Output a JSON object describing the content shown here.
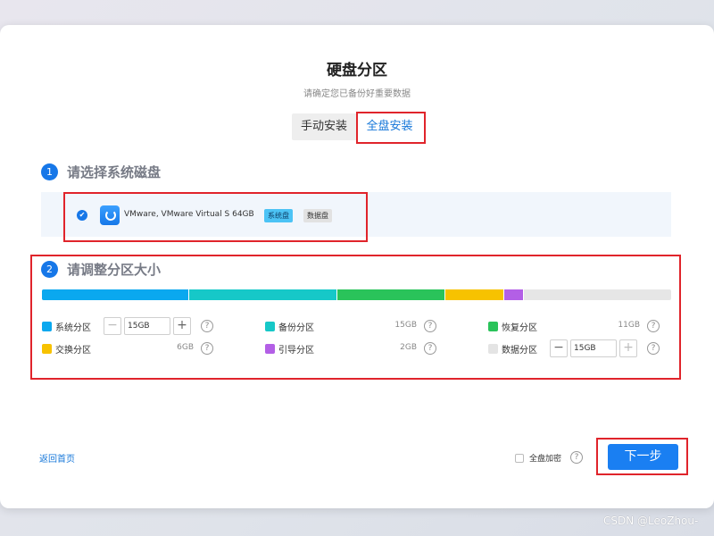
{
  "dialog": {
    "title": "硬盘分区",
    "subtitle": "请确定您已备份好重要数据"
  },
  "tabs": [
    {
      "label": "手动安装",
      "active": false
    },
    {
      "label": "全盘安装",
      "active": true
    }
  ],
  "step1": {
    "number": "1",
    "title": "请选择系统磁盘",
    "disk": {
      "name": "VMware, VMware Virtual S 64GB",
      "tags": [
        "系统盘",
        "数据盘"
      ],
      "selected": true
    }
  },
  "step2": {
    "number": "2",
    "title": "请调整分区大小",
    "bar_colors": [
      "#0aa8ef",
      "#16c8c8",
      "#2ac35a",
      "#f7c200",
      "#b35fe6"
    ],
    "bar_fractions": [
      0.2344,
      0.2344,
      0.1719,
      0.0938,
      0.0313
    ],
    "partitions": [
      {
        "label": "系统分区",
        "size": "15GB",
        "color": "#0aa8ef",
        "editable": true,
        "input_value": "15GB"
      },
      {
        "label": "备份分区",
        "size": "15GB",
        "color": "#16c8c8",
        "editable": false
      },
      {
        "label": "恢复分区",
        "size": "11GB",
        "color": "#2ac35a",
        "editable": false
      },
      {
        "label": "交换分区",
        "size": "6GB",
        "color": "#f7c200",
        "editable": false
      },
      {
        "label": "引导分区",
        "size": "2GB",
        "color": "#b35fe6",
        "editable": false
      },
      {
        "label": "数据分区",
        "size": "15GB",
        "color": "#e4e4e4",
        "editable": true,
        "input_value": "15GB"
      }
    ],
    "stepper_minus": "−",
    "stepper_plus": "+",
    "help_icon_text": "?"
  },
  "footer": {
    "back_label": "返回首页",
    "encrypt_label": "全盘加密",
    "encrypt_checked": false,
    "next_label": "下一步"
  },
  "watermark": "CSDN @LeoZhou-",
  "colors": {
    "accent": "#1677e8",
    "highlight_box": "#e0242b"
  }
}
